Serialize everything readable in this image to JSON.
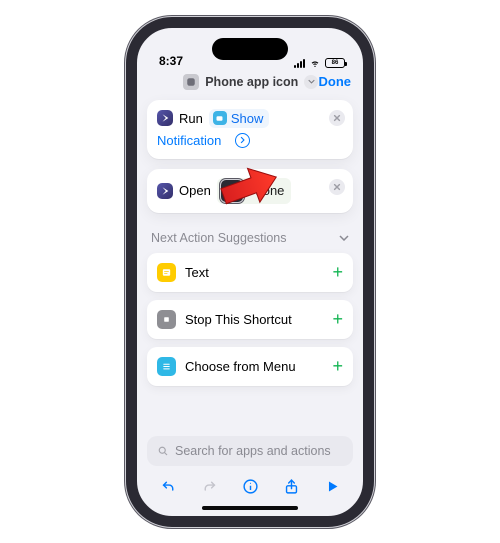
{
  "status": {
    "time": "8:37",
    "battery_label": "86"
  },
  "header": {
    "title": "Phone app icon",
    "done": "Done"
  },
  "actions": {
    "run": {
      "app_icon": "shortcuts-icon",
      "verb": "Run",
      "token_label": "Show",
      "continuation": "Notification"
    },
    "open": {
      "app_icon": "shortcuts-icon",
      "verb": "Open",
      "target": "Phone"
    }
  },
  "suggestions": {
    "header": "Next Action Suggestions",
    "items": [
      {
        "icon": "text-icon",
        "label": "Text"
      },
      {
        "icon": "stop-icon",
        "label": "Stop This Shortcut"
      },
      {
        "icon": "menu-icon",
        "label": "Choose from Menu"
      }
    ]
  },
  "search": {
    "placeholder": "Search for apps and actions"
  },
  "colors": {
    "accent": "#007aff",
    "success": "#34c759"
  }
}
